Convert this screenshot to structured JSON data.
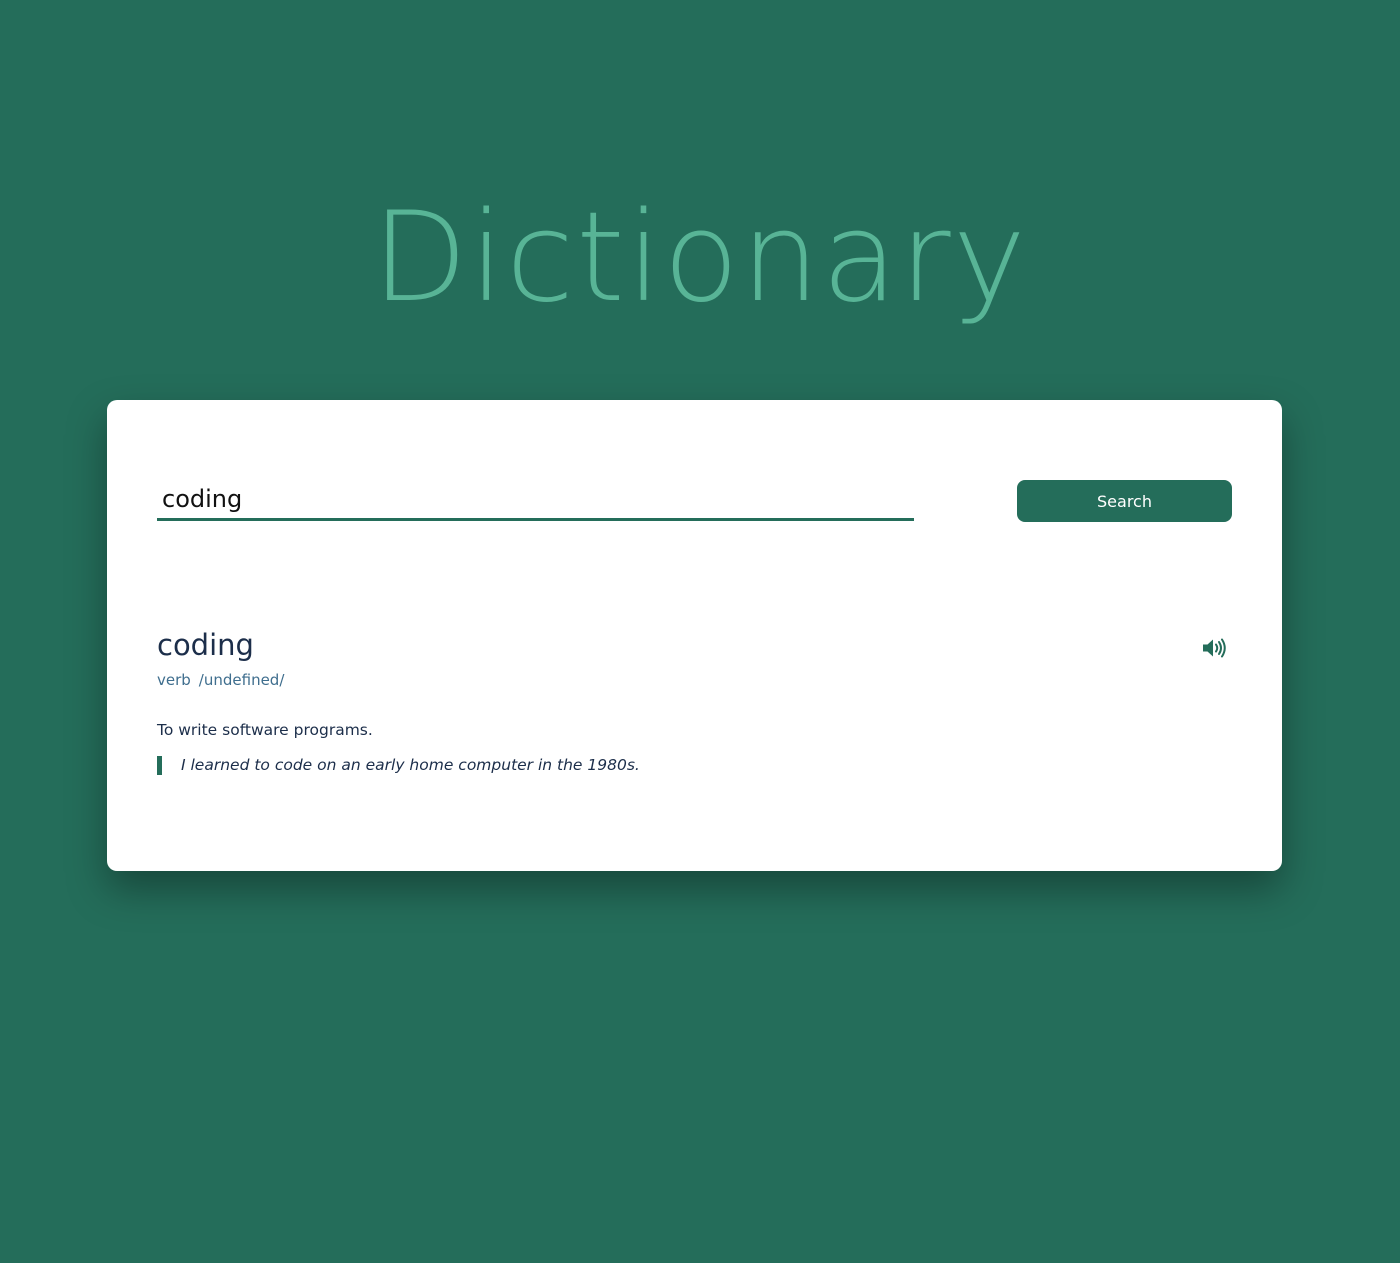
{
  "app": {
    "title": "Dictionary"
  },
  "search": {
    "value": "coding",
    "button_label": "Search"
  },
  "result": {
    "word": "coding",
    "part_of_speech": "verb",
    "phonetic": "/undefined/",
    "audio_icon": "speaker-icon",
    "definition": "To write software programs.",
    "example": "I learned to code on an early home computer in the 1980s."
  },
  "colors": {
    "background": "#246d5a",
    "title": "#58b496",
    "accent": "#246d5a",
    "card": "#ffffff",
    "text_dark": "#1c2e4a",
    "text_meta": "#3f6e8e"
  }
}
